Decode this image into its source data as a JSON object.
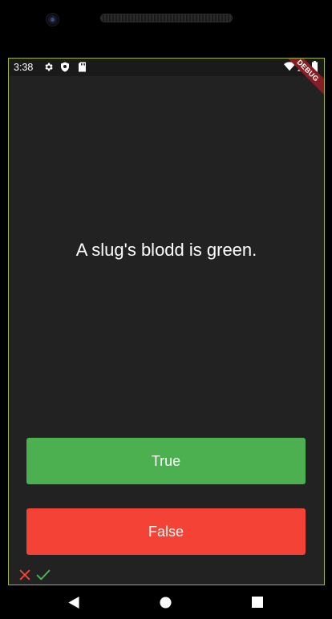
{
  "status_bar": {
    "time": "3:38",
    "icons": [
      "settings-icon",
      "shield-icon",
      "sd-card-icon",
      "wifi-icon",
      "signal-icon",
      "battery-icon"
    ]
  },
  "debug_banner": "DEBUG",
  "question": {
    "text": "A slug's blodd is green."
  },
  "buttons": {
    "true_label": "True",
    "false_label": "False"
  },
  "score_keeper": {
    "icons": [
      "close-icon",
      "check-icon"
    ]
  },
  "colors": {
    "background": "#222222",
    "true_button": "#4caf50",
    "false_button": "#f44336",
    "wrong_icon": "#f44336",
    "right_icon": "#4caf50",
    "debug_banner": "#8a1d24"
  },
  "nav_bar": {
    "icons": [
      "back-icon",
      "home-icon",
      "recents-icon"
    ]
  }
}
